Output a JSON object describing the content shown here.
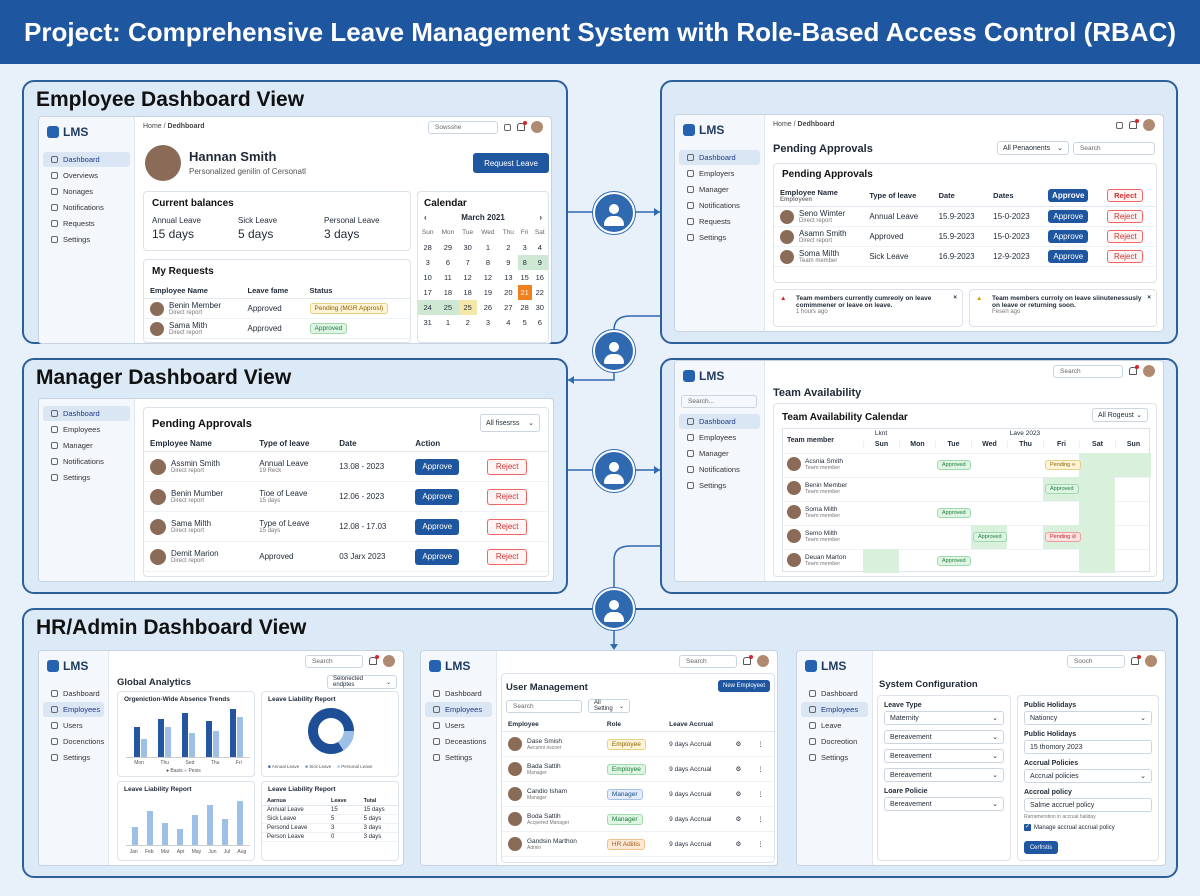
{
  "title": "Project: Comprehensive Leave Management System with Role-Based Access Control (RBAC)",
  "sections": {
    "employee": "Employee Dashboard View",
    "manager": "Manager Dashboard View",
    "hr": "HR/Admin Dashboard View"
  },
  "app": "LMS",
  "emp": {
    "nav": [
      "Dashboard",
      "Overviews",
      "Nonages",
      "Notifications",
      "Requests",
      "Settings"
    ],
    "search": "Sowsshe",
    "home": "Home",
    "crumb": "Dedhboard",
    "name": "Hannan Smith",
    "tagline": "Personalized genilin of Cersonatl",
    "request_btn": "Request Leave",
    "balances_title": "Current balances",
    "balances": [
      {
        "label": "Annual Leave",
        "val": "15 days"
      },
      {
        "label": "Sick Leave",
        "val": "5 days"
      },
      {
        "label": "Personal Leave",
        "val": "3 days"
      }
    ],
    "myreq_title": "My Requests",
    "myreq_cols": [
      "Employee Name",
      "Leave fame",
      "Status"
    ],
    "myreq": [
      {
        "name": "Benin Member",
        "sub": "Direct report",
        "type": "Approved",
        "status": "Pending (MGR Approsl)"
      },
      {
        "name": "Sama Mith",
        "sub": "Direct report",
        "type": "Approved",
        "status": "Approved"
      }
    ],
    "cal_title": "Calendar",
    "cal_month": "March 2021",
    "cal_prev": "‹",
    "cal_next": "›",
    "cal_days": [
      "Sun",
      "Mon",
      "Tue",
      "Wed",
      "Thu",
      "Fri",
      "Sat"
    ],
    "cal_rows": [
      [
        "28",
        "29",
        "30",
        "1",
        "2",
        "3",
        "4"
      ],
      [
        "3",
        "6",
        "7",
        "8",
        "9",
        "8",
        "9"
      ],
      [
        "10",
        "11",
        "12",
        "12",
        "13",
        "15",
        "16"
      ],
      [
        "17",
        "18",
        "18",
        "19",
        "20",
        "21",
        "22"
      ],
      [
        "24",
        "25",
        "25",
        "26",
        "27",
        "28",
        "30"
      ],
      [
        "31",
        "1",
        "2",
        "3",
        "4",
        "5",
        "6"
      ]
    ]
  },
  "approvals": {
    "nav": [
      "Dashboard",
      "Employers",
      "Manager",
      "Notifications",
      "Requests",
      "Settings"
    ],
    "home": "Home",
    "crumb": "Dedhboard",
    "title": "Pending Approvals",
    "filter": "All Penaonents",
    "search": "Search",
    "card_title": "Pending Approvals",
    "cols": [
      "Employee Name",
      "Type of leave",
      "Date",
      "Dates"
    ],
    "col_sub": "Employeen",
    "approve": "Approve",
    "reject": "Reject",
    "rows": [
      {
        "name": "Seno Wimter",
        "sub": "Direct report",
        "type": "Annual Leave",
        "d1": "15.9-2023",
        "d2": "15-0-2023"
      },
      {
        "name": "Asamn Smith",
        "sub": "Direct report",
        "type": "Approved",
        "d1": "15.9-2023",
        "d2": "15-0-2023"
      },
      {
        "name": "Soma Milth",
        "sub": "Team member",
        "type": "Sick Leave",
        "d1": "16.9-2023",
        "d2": "12-9-2023"
      }
    ],
    "alerts": [
      {
        "text": "Team members currently cumreoly on leave comimmener or leave on leave.",
        "time": "1 hours ago"
      },
      {
        "text": "Team members curroly on leave siinutenessusly on leave or returning soon.",
        "time": "Fesen ago"
      }
    ]
  },
  "mgr": {
    "nav": [
      "Dashboard",
      "Employees",
      "Manager",
      "Notifications",
      "Settings"
    ],
    "title": "Pending Approvals",
    "filter": "All fisesrss",
    "cols": [
      "Employee Name",
      "Type of leave",
      "Date",
      "Action"
    ],
    "approve": "Approve",
    "reject": "Reject",
    "rows": [
      {
        "name": "Assmin Smith",
        "sub": "Direct report",
        "type": "Annual Leave",
        "tsub": "19 Reck",
        "date": "13.08 - 2023"
      },
      {
        "name": "Benin Mumber",
        "sub": "Direct report",
        "type": "Tioe of Leave",
        "tsub": "15 days",
        "date": "12.06 - 2023"
      },
      {
        "name": "Sama Milth",
        "sub": "Direct report",
        "type": "Type of Leave",
        "tsub": "15 days",
        "date": "12.08 - 17.03"
      },
      {
        "name": "Demit Marion",
        "sub": "Direct report",
        "type": "Approved",
        "tsub": "",
        "date": "03 Jarx 2023"
      }
    ]
  },
  "team": {
    "search": "Search...",
    "topsearch": "Search",
    "nav": [
      "Dashboard",
      "Employees",
      "Manager",
      "Notifications",
      "Settings"
    ],
    "title": "Team Availability",
    "cal_title": "Team Availability Calendar",
    "filter": "All Rogeust",
    "col_member": "Team member",
    "h1": "Lknt",
    "h2": "Lave 2023",
    "days": [
      "Sun",
      "Mon",
      "Tue",
      "Wed",
      "Thu",
      "Fri",
      "Sat",
      "Sun"
    ],
    "rows": [
      {
        "name": "Acsnia Smith",
        "sub": "Team member",
        "pills": [
          {
            "col": 2,
            "t": "Approved",
            "c": "app"
          },
          {
            "col": 5,
            "t": "Pending ∞",
            "c": "pen"
          }
        ]
      },
      {
        "name": "Benin Member",
        "sub": "Team member",
        "pills": [
          {
            "col": 5,
            "t": "Approved",
            "c": "app"
          }
        ]
      },
      {
        "name": "Soma Milth",
        "sub": "Team member",
        "pills": [
          {
            "col": 2,
            "t": "Approved",
            "c": "app"
          }
        ]
      },
      {
        "name": "Semo Milth",
        "sub": "Team member",
        "pills": [
          {
            "col": 3,
            "t": "Approved",
            "c": "app"
          },
          {
            "col": 5,
            "t": "Pending ⊘",
            "c": "pr"
          }
        ]
      },
      {
        "name": "Deuan Marton",
        "sub": "Team member",
        "pills": [
          {
            "col": 2,
            "t": "Approved",
            "c": "app"
          }
        ]
      }
    ]
  },
  "ga": {
    "nav": [
      "Dashboard",
      "Employees",
      "Users",
      "Docenctions",
      "Settings"
    ],
    "search": "Search",
    "title": "Global Analytics",
    "filter": "Selonected endptes",
    "trend_title": "Orgeniction-Wide Absence Trends",
    "trend_x": [
      "Mon",
      "Thu",
      "Sed",
      "Thu",
      "Fri"
    ],
    "trend_legend": [
      "Basis",
      "Pesis"
    ],
    "liab_title": "Leave Liability Report",
    "donut_legend": [
      "Annual Leave",
      "Sick Leave",
      "Personal Leave"
    ],
    "liab2_title": "Leave Liability Report",
    "months": [
      "Jan",
      "Feb",
      "Mar",
      "Apr",
      "May",
      "Jun",
      "Jul",
      "Aug"
    ],
    "liab3_title": "Leave Liability Report",
    "tcols": [
      "Aarnua",
      "Leave",
      "Tutal"
    ],
    "trows": [
      [
        "Annual Leave",
        "15",
        "15 days"
      ],
      [
        "Sick Leave",
        "5",
        "5 days"
      ],
      [
        "Persond Leave",
        "3",
        "3 days"
      ],
      [
        "Person Leave",
        "0",
        "3 days"
      ]
    ]
  },
  "um": {
    "nav": [
      "Dashboard",
      "Employees",
      "Users",
      "Deceastions",
      "Settings"
    ],
    "topsearch": "Search",
    "title": "User Management",
    "new_btn": "New Employeet",
    "search": "Search",
    "filter": "All Setting",
    "cols": [
      "Employee",
      "Role",
      "Leave Accrual"
    ],
    "rows": [
      {
        "name": "Dase Smish",
        "sub": "Aecunni nscoer",
        "role": "Employee",
        "c": "pen",
        "acc": "9 days Accrual"
      },
      {
        "name": "Bada Sattih",
        "sub": "Manager",
        "role": "Employee",
        "c": "app",
        "acc": "9 days Accrual"
      },
      {
        "name": "Candio Isham",
        "sub": "Manager",
        "role": "Manager",
        "c": "blu",
        "acc": "9 days Accrual"
      },
      {
        "name": "Boda Sattih",
        "sub": "Accpered Manager",
        "role": "Manager",
        "c": "app",
        "acc": "9 days Accrual"
      },
      {
        "name": "Gandsin Marthon",
        "sub": "Admin",
        "role": "HR Adiitis",
        "c": "or",
        "acc": "9 days Accrual"
      }
    ]
  },
  "sc": {
    "nav": [
      "Dashboard",
      "Employees",
      "Leave",
      "Docreotion",
      "Settings"
    ],
    "topsearch": "Sooch",
    "title": "System Configuration",
    "lt_label": "Leave Type",
    "lt": [
      "Maternity",
      "Bereavement",
      "Bereavement",
      "Bereavement"
    ],
    "lp_label": "Loare Policie",
    "lp": "Bereavement",
    "ph_label": "Public Holidays",
    "ph": "Nationcy",
    "ph2_label": "Public Holidays",
    "ph2": "15 thomory 2023",
    "ap_label": "Accrual Policies",
    "ap": "Accrual policies",
    "ap2_label": "Accroal policy",
    "ap2": "Salme accruel policy",
    "ap2_sub": "Rarramerstion in accrual haliday",
    "check": "Manage accrual accrual policy",
    "btn": "Cerfrstis"
  }
}
